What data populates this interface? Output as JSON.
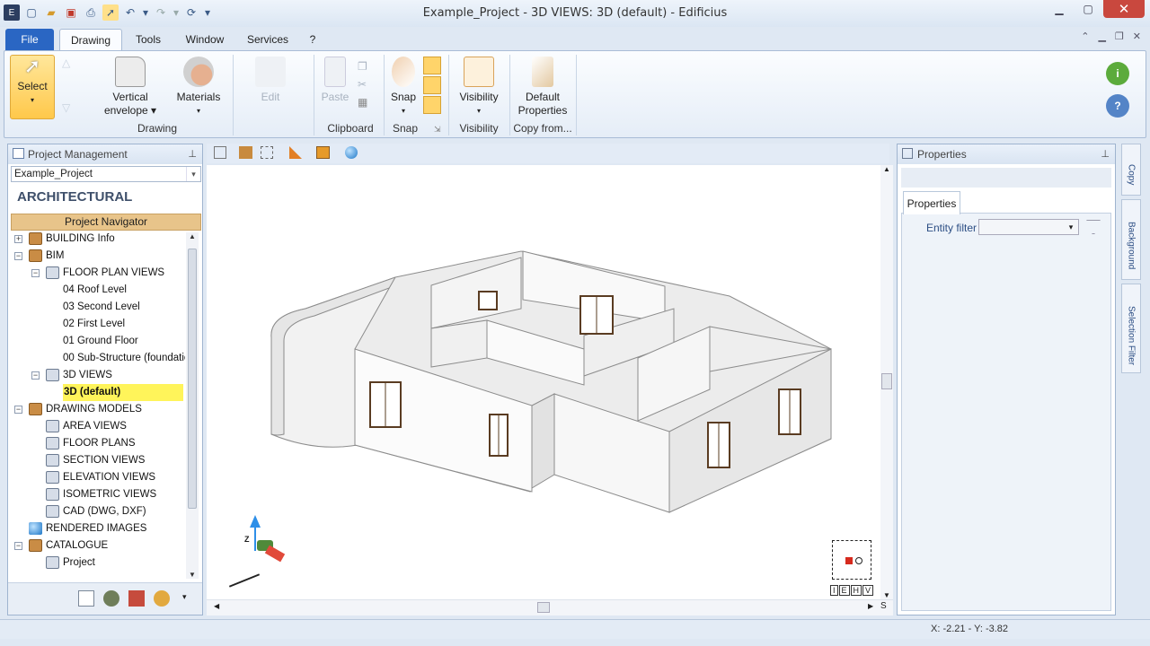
{
  "window": {
    "title": "Example_Project - 3D VIEWS: 3D (default) - Edificius"
  },
  "menu_tabs": [
    "File",
    "Drawing",
    "Tools",
    "Window",
    "Services",
    "?"
  ],
  "ribbon": {
    "select": "Select",
    "vertical_envelope_1": "Vertical",
    "vertical_envelope_2": "envelope",
    "materials": "Materials",
    "edit": "Edit",
    "paste": "Paste",
    "snap": "Snap",
    "visibility": "Visibility",
    "default_properties_1": "Default",
    "default_properties_2": "Properties",
    "group_drawing": "Drawing",
    "group_clipboard": "Clipboard",
    "group_snap": "Snap",
    "group_visibility": "Visibility",
    "group_copy_from": "Copy from..."
  },
  "project_panel": {
    "title": "Project Management",
    "project_select": "Example_Project",
    "heading": "ARCHITECTURAL",
    "navigator": "Project Navigator"
  },
  "tree": [
    {
      "label": "BUILDING Info",
      "exp": "+",
      "level": 0
    },
    {
      "label": "BIM",
      "exp": "−",
      "level": 0
    },
    {
      "label": "FLOOR PLAN VIEWS",
      "exp": "−",
      "level": 1
    },
    {
      "label": "04 Roof Level",
      "exp": "",
      "level": 2
    },
    {
      "label": "03 Second Level",
      "exp": "",
      "level": 2
    },
    {
      "label": "02 First Level",
      "exp": "",
      "level": 2
    },
    {
      "label": "01 Ground Floor",
      "exp": "",
      "level": 2
    },
    {
      "label": "00 Sub-Structure (foundatic",
      "exp": "",
      "level": 2
    },
    {
      "label": "3D VIEWS",
      "exp": "−",
      "level": 1
    },
    {
      "label": "3D (default)",
      "exp": "",
      "level": 2,
      "selected": true
    },
    {
      "label": "DRAWING MODELS",
      "exp": "−",
      "level": 0
    },
    {
      "label": "AREA VIEWS",
      "exp": "",
      "level": 1
    },
    {
      "label": "FLOOR PLANS",
      "exp": "",
      "level": 1
    },
    {
      "label": "SECTION VIEWS",
      "exp": "",
      "level": 1
    },
    {
      "label": "ELEVATION VIEWS",
      "exp": "",
      "level": 1
    },
    {
      "label": "ISOMETRIC VIEWS",
      "exp": "",
      "level": 1
    },
    {
      "label": "CAD (DWG, DXF)",
      "exp": "",
      "level": 1
    },
    {
      "label": "RENDERED IMAGES",
      "exp": "",
      "level": 0
    },
    {
      "label": "CATALOGUE",
      "exp": "−",
      "level": 0
    },
    {
      "label": "Project",
      "exp": "",
      "level": 1
    }
  ],
  "properties_panel": {
    "title": "Properties",
    "tab": "Properties",
    "entity_filter_label": "Entity filter"
  },
  "side_tabs": [
    "Copy",
    "Background",
    "Selection Filter"
  ],
  "view_cube_letters": [
    "I",
    "E",
    "H",
    "V"
  ],
  "axis_label": "Z",
  "status": {
    "coords": "X: -2.21 - Y: -3.82"
  },
  "scroll_letter": "S",
  "colors": {
    "accent": "#2a66c3",
    "selection": "#fff45a",
    "navigator": "#e8c48a"
  }
}
